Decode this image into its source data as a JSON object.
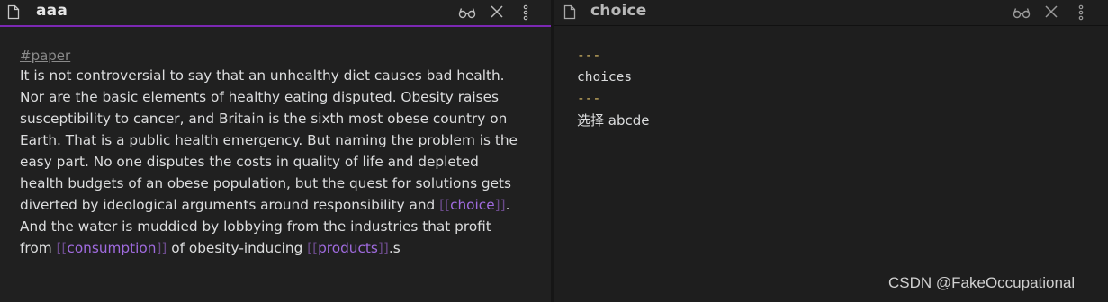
{
  "left_pane": {
    "title": "aaa",
    "tag": "#paper",
    "text_1": "It is not controversial to say that an unhealthy diet causes bad health. Nor are the basic elements of healthy eating disputed. Obesity raises susceptibility to cancer, and Britain is the sixth most obese country on Earth. That is a public health emergency. But naming the problem is the easy part. No one disputes the costs in quality of life and depleted health budgets of an obese population, but the quest for solutions gets diverted by ideological arguments around responsibility and ",
    "link_choice": "choice",
    "text_2": ". And the water is muddied by lobbying from the industries that profit from ",
    "link_consumption": "consumption",
    "text_3": " of obesity-inducing ",
    "link_products": "products",
    "text_4": ".s",
    "bracket_open": "[[",
    "bracket_close": "]]"
  },
  "right_pane": {
    "title": "choice",
    "fm_open": "---",
    "fm_key": "choices",
    "fm_close": "---",
    "body": "选择 abcde"
  },
  "watermark": "CSDN @FakeOccupational",
  "icons": {
    "file": "file-icon",
    "reading_view": "glasses-icon",
    "close": "close-icon",
    "more": "more-vertical-icon"
  },
  "colors": {
    "accent": "#7b28b3",
    "link": "#a06bdf",
    "frontmatter_dash": "#e2c26b"
  }
}
